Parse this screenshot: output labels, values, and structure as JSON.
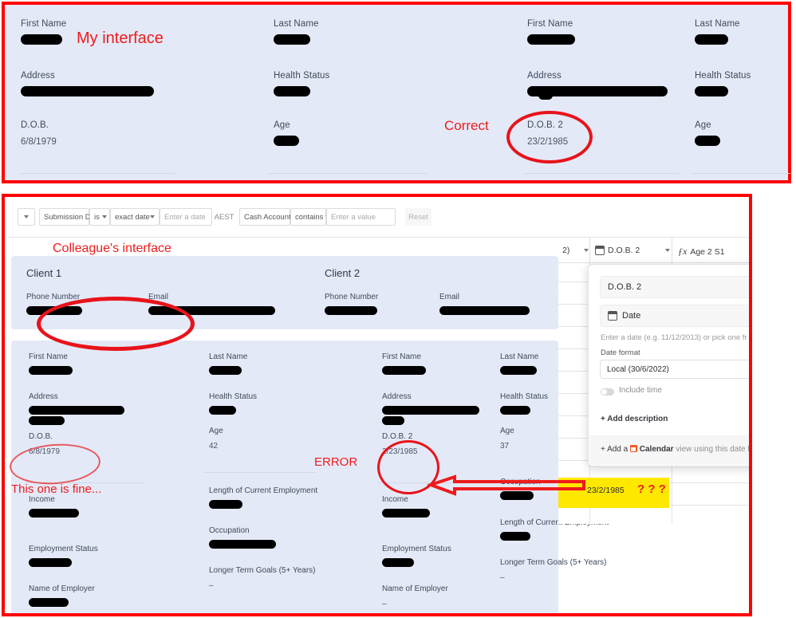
{
  "annotations": {
    "my_interface": "My interface",
    "correct": "Correct",
    "colleague_interface": "Colleague's interface",
    "this_one_is_fine": "This one is fine...",
    "error": "ERROR",
    "question_marks": "? ? ?"
  },
  "top_panel": {
    "client_a": {
      "first_name_label": "First Name",
      "last_name_label": "Last Name",
      "address_label": "Address",
      "health_status_label": "Health Status",
      "dob_label": "D.O.B.",
      "dob_value": "6/8/1979",
      "age_label": "Age"
    },
    "client_b": {
      "first_name_label": "First Name",
      "last_name_label": "Last Name",
      "address_label": "Address",
      "health_status_label": "Health Status",
      "dob_label": "D.O.B. 2",
      "dob_value": "23/2/1985",
      "age_label": "Age"
    }
  },
  "filter_toolbar": {
    "field_1": "Submission D...",
    "operator_1": "is",
    "date_mode": "exact date",
    "date_placeholder": "Enter a date",
    "timezone": "AEST",
    "field_2": "Cash Account...",
    "operator_2": "contains",
    "value_placeholder": "Enter a value",
    "reset_label": "Reset"
  },
  "contact_card": {
    "client1_title": "Client 1",
    "client2_title": "Client 2",
    "phone_label": "Phone Number",
    "email_label": "Email"
  },
  "bottom_panel": {
    "client1": {
      "first_name_label": "First Name",
      "last_name_label": "Last Name",
      "address_label": "Address",
      "health_status_label": "Health Status",
      "dob_label": "D.O.B.",
      "dob_value": "6/8/1979",
      "age_label": "Age",
      "age_value": "42",
      "income_label": "Income",
      "length_employment_label": "Length of Current Employment",
      "employment_status_label": "Employment Status",
      "occupation_label": "Occupation",
      "name_of_employer_label": "Name of Employer",
      "longer_term_goals_label": "Longer Term Goals (5+ Years)",
      "longer_term_goals_value": "–"
    },
    "client2": {
      "first_name_label": "First Name",
      "last_name_label": "Last Name",
      "address_label": "Address",
      "health_status_label": "Health Status",
      "dob_label": "D.O.B. 2",
      "dob_value": "2/23/1985",
      "age_label": "Age",
      "age_value": "37",
      "income_label": "Income",
      "occupation_label": "Occupation",
      "employment_status_label": "Employment Status",
      "length_employment_label": "Length of Current Employment",
      "name_of_employer_label": "Name of Employer",
      "name_of_employer_value": "–",
      "longer_term_goals_label": "Longer Term Goals (5+ Years)",
      "longer_term_goals_value": "–"
    }
  },
  "grid_header": {
    "col_left_partial": "2)",
    "col_dob2": "D.O.B. 2",
    "col_age2s1": "Age 2 S1"
  },
  "field_popup": {
    "field_name": "D.O.B. 2",
    "type_label": "Date",
    "hint": "Enter a date (e.g. 11/12/2013) or pick one fr",
    "date_format_label": "Date format",
    "date_format_value": "Local (30/6/2022)",
    "include_time_label": "Include time",
    "add_description_label": "+ Add description",
    "calendar_prefix": "+ Add a",
    "calendar_word": "Calendar",
    "calendar_suffix": "view using this date f"
  },
  "grid_cell": {
    "highlighted_value": "23/2/1985"
  },
  "colors": {
    "annotation_red": "#ee1c1c",
    "panel_bg": "#e4e9f7",
    "highlight_yellow": "#ffe800",
    "border_red": "#ff0000"
  }
}
